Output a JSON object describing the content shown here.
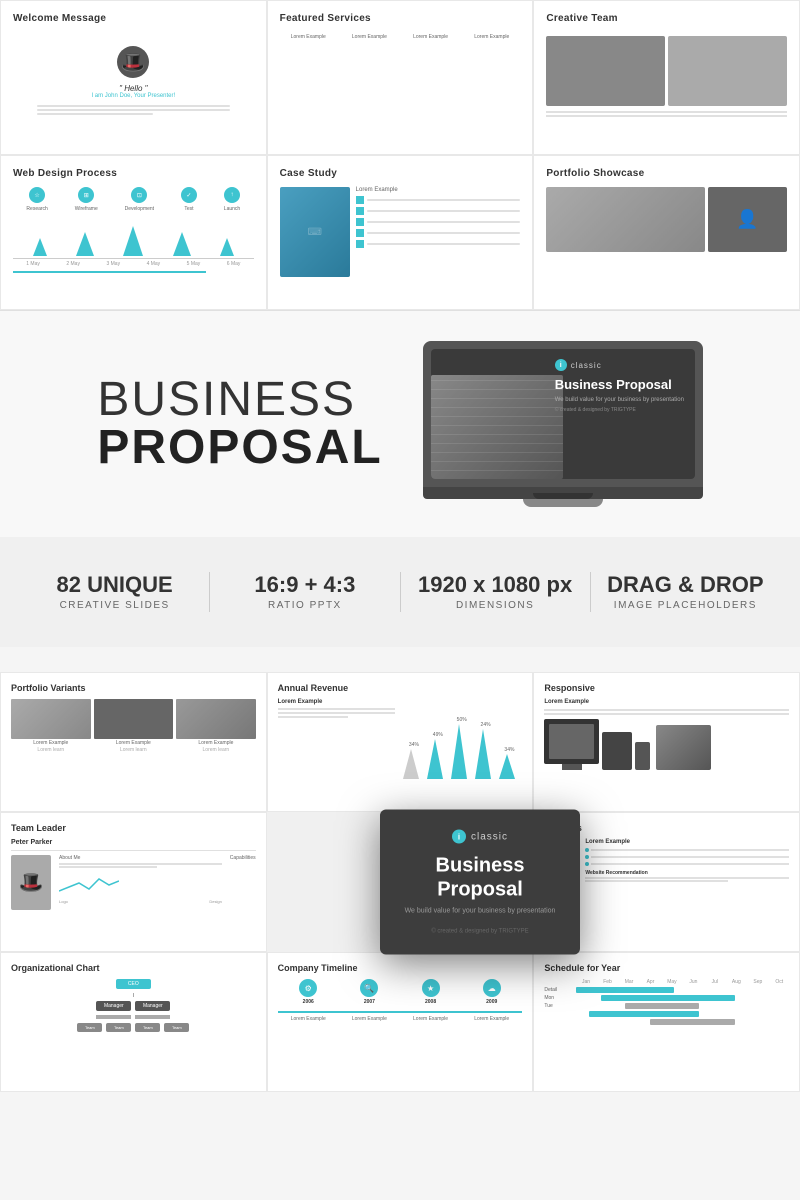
{
  "top_slides": {
    "slide1": {
      "title": "Welcome Message",
      "hello": "\" Hello \"",
      "sub": "I am John Doe, Your Presenter!"
    },
    "slide2": {
      "title": "Featured Services",
      "labels": [
        "Lorem Example",
        "Lorem Example",
        "Lorem Example",
        "Lorem Example"
      ]
    },
    "slide3": {
      "title": "Creative Team"
    },
    "slide4": {
      "title": "Web Design Process",
      "steps": [
        "Research",
        "Wireframe",
        "Development",
        "Test",
        "Launch"
      ],
      "timeline": [
        "1 May",
        "2 May",
        "3 May",
        "4 May",
        "5 May",
        "6 May"
      ]
    },
    "slide5": {
      "title": "Case Study",
      "label": "Lorem Example"
    },
    "slide6": {
      "title": "Portfolio Showcase"
    }
  },
  "hero": {
    "line1": "BUSINESS",
    "line2": "PROPOSAL",
    "laptop_brand": "classic",
    "laptop_title": "Business Proposal",
    "laptop_sub": "We build value for your business by presentation",
    "laptop_credit": "© created & designed by TRIGTYPE"
  },
  "stats": [
    {
      "number": "82 UNIQUE",
      "label": "CREATIVE SLIDES"
    },
    {
      "number": "16:9 + 4:3",
      "label": "RATIO PPTX"
    },
    {
      "number": "1920 x 1080 px",
      "label": "DIMENSIONS"
    },
    {
      "number": "DRAG & DROP",
      "label": "IMAGE PLACEHOLDERS"
    }
  ],
  "bottom_slides": {
    "portfolio_variants": {
      "title": "Portfolio Variants",
      "captions": [
        "Lorem Example",
        "Lorem Example",
        "Lorem Example"
      ]
    },
    "annual_revenue": {
      "title": "Annual Revenue",
      "label": "Lorem Example",
      "bars": [
        "34%",
        "49%",
        "50%",
        "24%",
        "34%"
      ]
    },
    "responsive": {
      "title": "Responsive",
      "label": "Lorem Example"
    },
    "team_leader": {
      "title": "Team Leader",
      "name": "Peter Parker",
      "about": "About Me",
      "capabilities": "Capabilities",
      "labels": [
        "Logo",
        "Design"
      ]
    },
    "features": {
      "title": "Features",
      "label": "Lorem Example",
      "website_rec": "Website Recommendation"
    },
    "org_chart": {
      "title": "Organizational Chart"
    },
    "company_timeline": {
      "title": "Company Timeline",
      "years": [
        "2006",
        "2007",
        "2008",
        "2009"
      ],
      "labels": [
        "Lorem Example",
        "Lorem Example",
        "Lorem Example",
        "Lorem Example"
      ]
    },
    "schedule": {
      "title": "Schedule for Year",
      "months": [
        "Jan",
        "Feb",
        "Mar",
        "Apr",
        "May",
        "Jun",
        "Jul",
        "Aug",
        "Sep",
        "Oct"
      ],
      "rows": [
        "Detail",
        "Mon",
        "Tue"
      ]
    }
  },
  "modal": {
    "brand": "classic",
    "title": "Business Proposal",
    "subtitle": "We build value for your business by presentation",
    "footer": "© created & designed by TRIGTYPE"
  }
}
